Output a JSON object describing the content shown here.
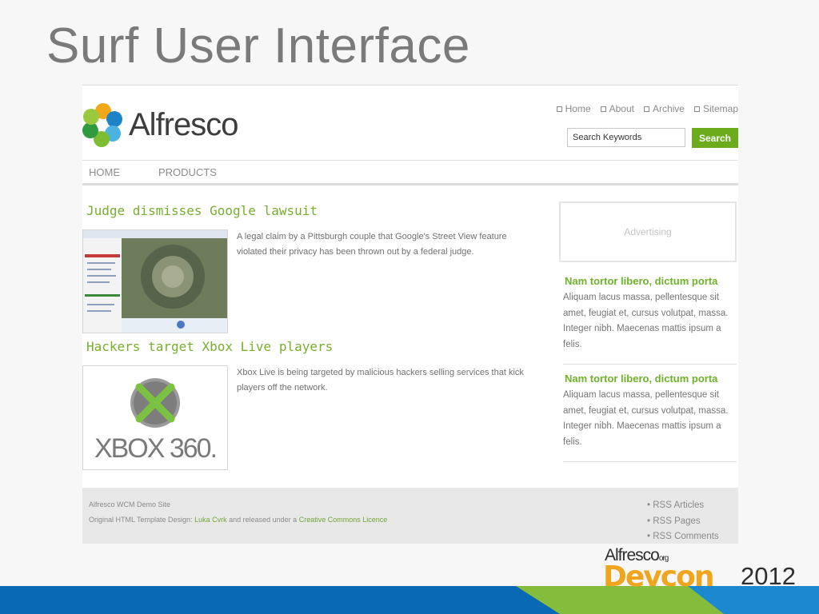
{
  "slide": {
    "title": "Surf User Interface"
  },
  "site": {
    "logo_text": "Alfresco",
    "top_nav": [
      "Home",
      "About",
      "Archive",
      "Sitemap"
    ],
    "search": {
      "placeholder": "Search Keywords",
      "button_label": "Search"
    },
    "main_nav": [
      "HOME",
      "PRODUCTS"
    ],
    "articles": [
      {
        "title": "Judge dismisses Google lawsuit",
        "text": "A legal claim by a Pittsburgh couple that Google's Street View feature violated their privacy has been thrown out by a federal judge."
      },
      {
        "title": "Hackers target Xbox Live players",
        "text": "Xbox Live is being targeted by malicious hackers selling services that kick players off the network.",
        "thumb_text": "XBOX 360."
      }
    ],
    "sidebar": {
      "ad_label": "Advertising",
      "items": [
        {
          "title": "Nam tortor libero, dictum porta",
          "text": "Aliquam lacus massa, pellentesque sit amet, feugiat et, cursus volutpat, massa. Integer nibh. Maecenas mattis ipsum a felis."
        },
        {
          "title": "Nam tortor libero, dictum porta",
          "text": "Aliquam lacus massa, pellentesque sit amet, feugiat et, cursus volutpat, massa. Integer nibh. Maecenas mattis ipsum a felis."
        }
      ]
    },
    "footer": {
      "site_name": "Alfresco WCM Demo Site",
      "credit_prefix": "Original HTML Template Design:",
      "credit_author": "Luka Cvrk",
      "credit_middle": "and released under a",
      "credit_license": "Creative Commons Licence",
      "rss": [
        "RSS Articles",
        "RSS Pages",
        "RSS Comments"
      ]
    }
  },
  "branding": {
    "alfresco": "Alfresco",
    "org": "org",
    "devcon": "Devcon",
    "year": "2012"
  },
  "colors": {
    "accent_green": "#6bab1c",
    "band_blue": "#0a69b5",
    "band_green": "#86bc3c",
    "devcon_orange": "#f0a51f"
  }
}
